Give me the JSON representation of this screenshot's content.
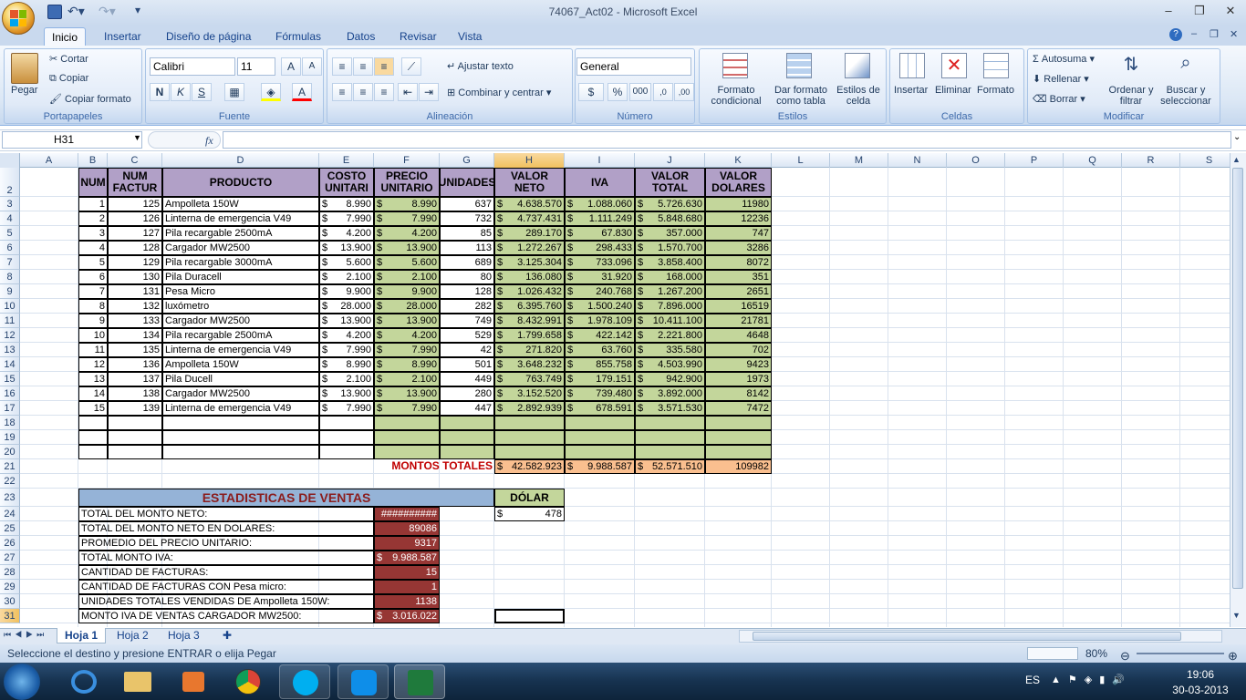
{
  "window": {
    "title": "74067_Act02 - Microsoft Excel"
  },
  "ribbon_tabs": [
    "Inicio",
    "Insertar",
    "Diseño de página",
    "Fórmulas",
    "Datos",
    "Revisar",
    "Vista"
  ],
  "ribbon": {
    "clipboard": {
      "paste": "Pegar",
      "cut": "Cortar",
      "copy": "Copiar",
      "format_painter": "Copiar formato",
      "label": "Portapapeles"
    },
    "font": {
      "family": "Calibri",
      "size": "11",
      "bold": "N",
      "italic": "K",
      "underline": "S",
      "label": "Fuente"
    },
    "alignment": {
      "wrap": "Ajustar texto",
      "merge": "Combinar y centrar",
      "label": "Alineación"
    },
    "number": {
      "format": "General",
      "currency": "$",
      "percent": "%",
      "thousands": "000",
      "label": "Número"
    },
    "styles": {
      "conditional": "Formato condicional",
      "as_table": "Dar formato como tabla",
      "cell_styles": "Estilos de celda",
      "label": "Estilos"
    },
    "cells": {
      "insert": "Insertar",
      "delete": "Eliminar",
      "format": "Formato",
      "label": "Celdas"
    },
    "editing": {
      "autosum": "Autosuma",
      "fill": "Rellenar",
      "clear": "Borrar",
      "sort": "Ordenar y filtrar",
      "find": "Buscar y seleccionar",
      "label": "Modificar"
    }
  },
  "formula_bar": {
    "name_box": "H31",
    "fx": "fx",
    "formula": ""
  },
  "columns": [
    "A",
    "B",
    "C",
    "D",
    "E",
    "F",
    "G",
    "H",
    "I",
    "J",
    "K",
    "L",
    "M",
    "N",
    "O",
    "P",
    "Q",
    "R",
    "S"
  ],
  "headers": {
    "B": "NUM",
    "C": "NUM FACTUR",
    "D": "PRODUCTO",
    "E": "COSTO UNITARI",
    "F": "PRECIO UNITARIO",
    "G": "UNIDADES",
    "H": "VALOR NETO",
    "I": "IVA",
    "J": "VALOR TOTAL",
    "K": "VALOR DOLARES"
  },
  "rows": [
    {
      "num": "1",
      "fact": "125",
      "prod": "Ampolleta 150W",
      "costo": "8.990",
      "precio": "8.990",
      "unid": "637",
      "neto": "4.638.570",
      "iva": "1.088.060",
      "total": "5.726.630",
      "dol": "11980"
    },
    {
      "num": "2",
      "fact": "126",
      "prod": "Linterna de emergencia V49",
      "costo": "7.990",
      "precio": "7.990",
      "unid": "732",
      "neto": "4.737.431",
      "iva": "1.111.249",
      "total": "5.848.680",
      "dol": "12236"
    },
    {
      "num": "3",
      "fact": "127",
      "prod": "Pila recargable 2500mA",
      "costo": "4.200",
      "precio": "4.200",
      "unid": "85",
      "neto": "289.170",
      "iva": "67.830",
      "total": "357.000",
      "dol": "747"
    },
    {
      "num": "4",
      "fact": "128",
      "prod": "Cargador MW2500",
      "costo": "13.900",
      "precio": "13.900",
      "unid": "113",
      "neto": "1.272.267",
      "iva": "298.433",
      "total": "1.570.700",
      "dol": "3286"
    },
    {
      "num": "5",
      "fact": "129",
      "prod": "Pila recargable 3000mA",
      "costo": "5.600",
      "precio": "5.600",
      "unid": "689",
      "neto": "3.125.304",
      "iva": "733.096",
      "total": "3.858.400",
      "dol": "8072"
    },
    {
      "num": "6",
      "fact": "130",
      "prod": "Pila Duracell",
      "costo": "2.100",
      "precio": "2.100",
      "unid": "80",
      "neto": "136.080",
      "iva": "31.920",
      "total": "168.000",
      "dol": "351"
    },
    {
      "num": "7",
      "fact": "131",
      "prod": "Pesa Micro",
      "costo": "9.900",
      "precio": "9.900",
      "unid": "128",
      "neto": "1.026.432",
      "iva": "240.768",
      "total": "1.267.200",
      "dol": "2651"
    },
    {
      "num": "8",
      "fact": "132",
      "prod": "luxómetro",
      "costo": "28.000",
      "precio": "28.000",
      "unid": "282",
      "neto": "6.395.760",
      "iva": "1.500.240",
      "total": "7.896.000",
      "dol": "16519"
    },
    {
      "num": "9",
      "fact": "133",
      "prod": "Cargador MW2500",
      "costo": "13.900",
      "precio": "13.900",
      "unid": "749",
      "neto": "8.432.991",
      "iva": "1.978.109",
      "total": "10.411.100",
      "dol": "21781"
    },
    {
      "num": "10",
      "fact": "134",
      "prod": "Pila recargable 2500mA",
      "costo": "4.200",
      "precio": "4.200",
      "unid": "529",
      "neto": "1.799.658",
      "iva": "422.142",
      "total": "2.221.800",
      "dol": "4648"
    },
    {
      "num": "11",
      "fact": "135",
      "prod": "Linterna de emergencia V49",
      "costo": "7.990",
      "precio": "7.990",
      "unid": "42",
      "neto": "271.820",
      "iva": "63.760",
      "total": "335.580",
      "dol": "702"
    },
    {
      "num": "12",
      "fact": "136",
      "prod": "Ampolleta 150W",
      "costo": "8.990",
      "precio": "8.990",
      "unid": "501",
      "neto": "3.648.232",
      "iva": "855.758",
      "total": "4.503.990",
      "dol": "9423"
    },
    {
      "num": "13",
      "fact": "137",
      "prod": "Pila Ducell",
      "costo": "2.100",
      "precio": "2.100",
      "unid": "449",
      "neto": "763.749",
      "iva": "179.151",
      "total": "942.900",
      "dol": "1973"
    },
    {
      "num": "14",
      "fact": "138",
      "prod": "Cargador MW2500",
      "costo": "13.900",
      "precio": "13.900",
      "unid": "280",
      "neto": "3.152.520",
      "iva": "739.480",
      "total": "3.892.000",
      "dol": "8142"
    },
    {
      "num": "15",
      "fact": "139",
      "prod": "Linterna de emergencia V49",
      "costo": "7.990",
      "precio": "7.990",
      "unid": "447",
      "neto": "2.892.939",
      "iva": "678.591",
      "total": "3.571.530",
      "dol": "7472"
    }
  ],
  "totals": {
    "label": "MONTOS TOTALES",
    "neto": "42.582.923",
    "iva": "9.988.587",
    "total": "52.571.510",
    "dol": "109982"
  },
  "currency_symbol": "$",
  "stats": {
    "title": "ESTADISTICAS DE VENTAS",
    "items": [
      {
        "label": "TOTAL DEL MONTO NETO:",
        "value": "##########",
        "money": false
      },
      {
        "label": "TOTAL DEL MONTO NETO EN DOLARES:",
        "value": "89086",
        "money": false
      },
      {
        "label": "PROMEDIO DEL PRECIO UNITARIO:",
        "value": "9317",
        "money": false
      },
      {
        "label": "TOTAL MONTO IVA:",
        "value": "9.988.587",
        "money": true
      },
      {
        "label": "CANTIDAD DE FACTURAS:",
        "value": "15",
        "money": false
      },
      {
        "label": "CANTIDAD DE FACTURAS CON Pesa micro:",
        "value": "1",
        "money": false
      },
      {
        "label": "UNIDADES TOTALES VENDIDAS DE Ampolleta 150W:",
        "value": "1138",
        "money": false
      },
      {
        "label": "MONTO IVA DE VENTAS CARGADOR MW2500:",
        "value": "3.016.022",
        "money": true
      }
    ]
  },
  "dollar": {
    "label": "DÓLAR",
    "value": "478"
  },
  "sheet_tabs": [
    "Hoja 1",
    "Hoja 2",
    "Hoja 3"
  ],
  "status": {
    "message": "Seleccione el destino y presione ENTRAR o elija Pegar",
    "zoom": "80%"
  },
  "taskbar": {
    "lang": "ES",
    "time": "19:06",
    "date": "30-03-2013"
  },
  "colors": {
    "header_purple": "#b1a0c7",
    "green": "#c3d69b",
    "dark_red": "#963634",
    "peach": "#fabf8f",
    "total_red": "#c00000",
    "stats_title": "#8b1c1c",
    "stats_bg": "#95b3d7"
  }
}
